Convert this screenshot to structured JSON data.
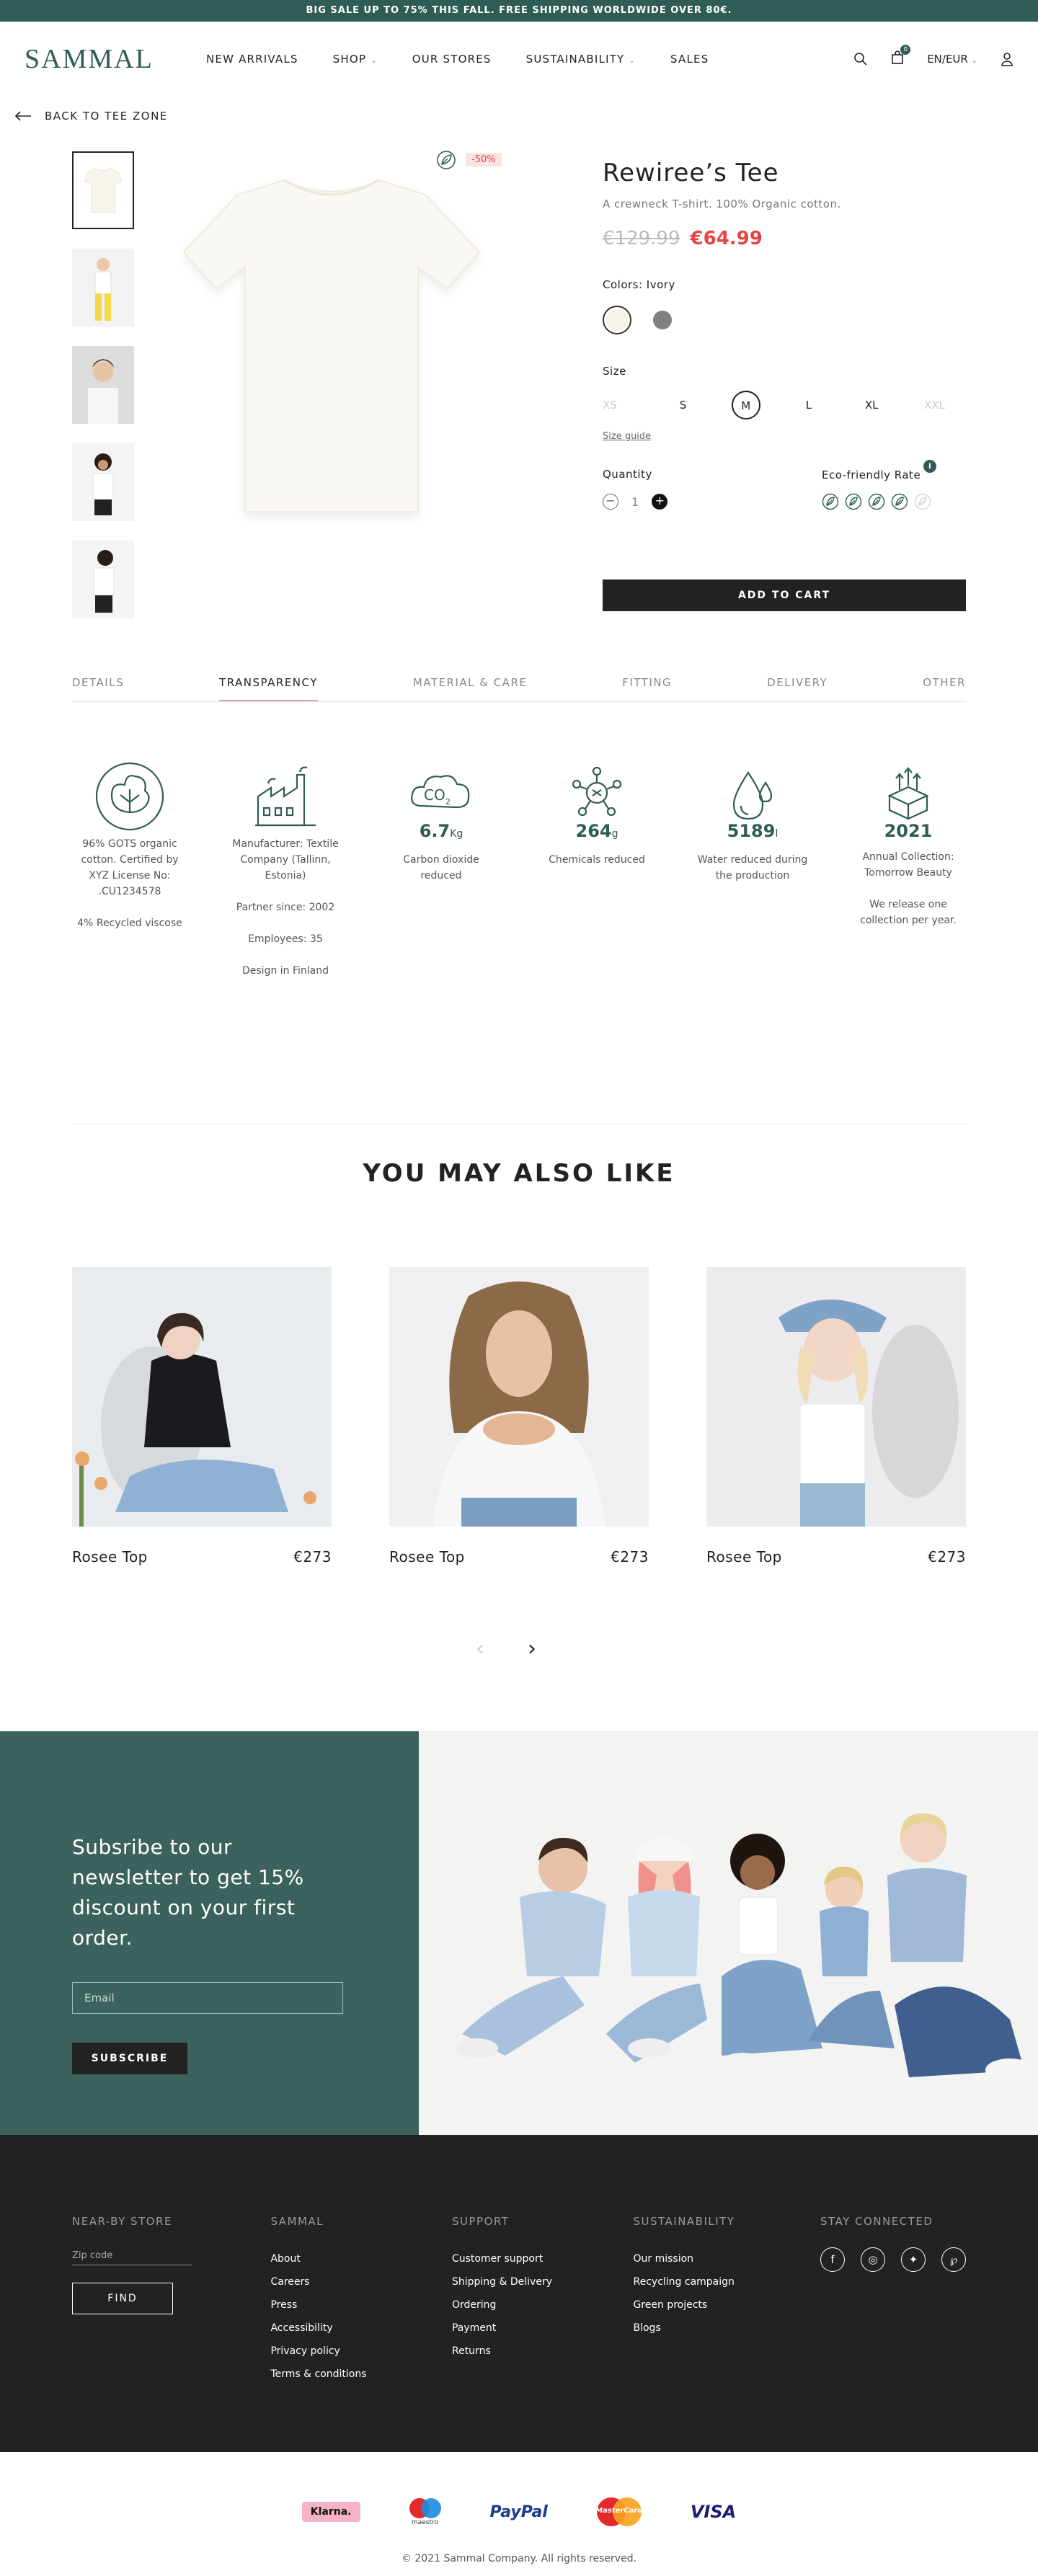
{
  "promo": "BIG SALE UP TO 75% THIS FALL. FREE SHIPPING WORLDWIDE OVER 80€.",
  "header": {
    "logo": "SAMMAL",
    "nav": [
      "NEW ARRIVALS",
      "SHOP",
      "OUR STORES",
      "SUSTAINABILITY",
      "SALES"
    ],
    "cart_count": "0",
    "locale": "EN/EUR"
  },
  "back_label": "BACK TO TEE ZONE",
  "product": {
    "discount": "-50%",
    "title": "Rewiree’s Tee",
    "subtitle": "A crewneck T-shirt. 100% Organic cotton.",
    "old_price": "€129.99",
    "new_price": "€64.99",
    "colors_label": "Colors: Ivory",
    "size_label": "Size",
    "sizes": [
      "XS",
      "S",
      "M",
      "L",
      "XL",
      "XXL"
    ],
    "size_guide": "Size guide",
    "quantity_label": "Quantity",
    "quantity": "1",
    "eco_label": "Eco-friendly Rate",
    "eco_rating": 4,
    "eco_max": 5,
    "add_to_cart": "ADD TO CART"
  },
  "tabs": [
    "DETAILS",
    "TRANSPARENCY",
    "MATERIAL & CARE",
    "FITTING",
    "DELIVERY",
    "OTHER"
  ],
  "metrics": [
    {
      "value": "",
      "unit": "",
      "text": [
        "96% GOTS organic cotton. Certified by XYZ License No: .CU1234578",
        "4% Recycled viscose"
      ]
    },
    {
      "value": "",
      "unit": "",
      "text": [
        "Manufacturer: Textile Company (Tallinn, Estonia)",
        "Partner since: 2002",
        "Employees: 35",
        "Design in Finland"
      ]
    },
    {
      "value": "6.7",
      "unit": "Kg",
      "text": [
        "Carbon dioxide reduced"
      ]
    },
    {
      "value": "264",
      "unit": "g",
      "text": [
        "Chemicals reduced"
      ]
    },
    {
      "value": "5189",
      "unit": "l",
      "text": [
        "Water reduced during the production"
      ]
    },
    {
      "value": "2021",
      "unit": "",
      "text": [
        "Annual Collection: Tomorrow Beauty",
        "We release one collection per year."
      ]
    }
  ],
  "co2_label": "CO",
  "co2_sub": "2",
  "also_like": "YOU MAY ALSO LIKE",
  "products": [
    {
      "name": "Rosee Top",
      "price": "€273"
    },
    {
      "name": "Rosee Top",
      "price": "€273"
    },
    {
      "name": "Rosee Top",
      "price": "€273"
    }
  ],
  "newsletter": {
    "title": "Subsribe to our newsletter to get 15% discount on your first order.",
    "placeholder": "Email",
    "button": "SUBSCRIBE"
  },
  "footer": {
    "store": {
      "title": "NEAR-BY STORE",
      "zip_placeholder": "Zip code",
      "button": "FIND"
    },
    "sammal": {
      "title": "SAMMAL",
      "links": [
        "About",
        "Careers",
        "Press",
        "Accessibility",
        "Privacy policy",
        "Terms & conditions"
      ]
    },
    "support": {
      "title": "SUPPORT",
      "links": [
        "Customer support",
        "Shipping & Delivery",
        "Ordering",
        "Payment",
        "Returns"
      ]
    },
    "sustainability": {
      "title": "SUSTAINABILITY",
      "links": [
        "Our mission",
        "Recycling campaign",
        "Green projects",
        "Blogs"
      ]
    },
    "connected": {
      "title": "STAY CONNECTED"
    }
  },
  "payments": {
    "klarna": "Klarna.",
    "maestro": "maestro",
    "paypal": "PayPal",
    "mastercard": "MasterCard",
    "visa": "VISA"
  },
  "copyright": "© 2021 Sammal Company. All rights reserved.",
  "colors": {
    "brand": "#2f5d55",
    "sale": "#e74545",
    "dark": "#222222"
  }
}
